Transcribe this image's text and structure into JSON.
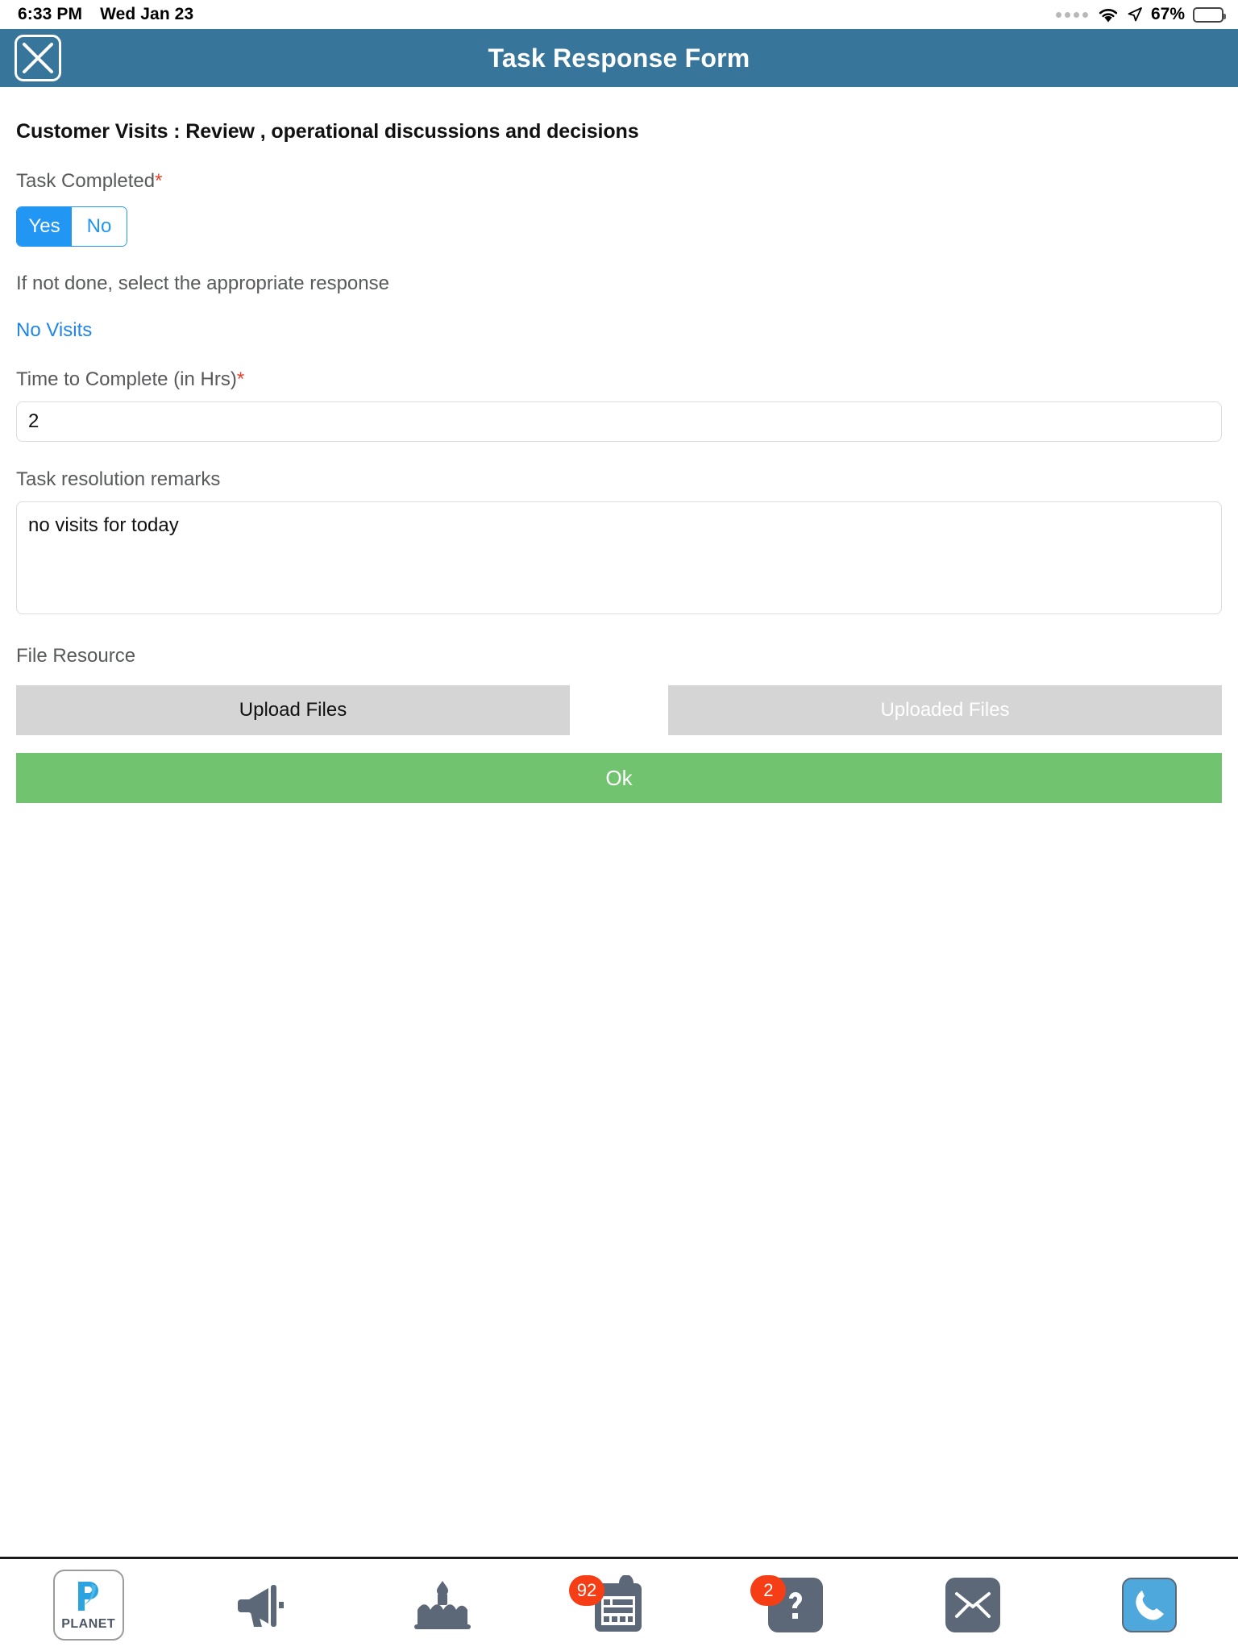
{
  "status_bar": {
    "time": "6:33 PM",
    "date": "Wed Jan 23",
    "battery_percent": "67%",
    "icons": [
      "signal-dots-icon",
      "wifi-icon",
      "location-arrow-icon",
      "battery-icon"
    ]
  },
  "header": {
    "title": "Task Response Form",
    "close_icon": "close-x-icon",
    "background_color": "#37759b"
  },
  "form": {
    "heading": "Customer Visits : Review , operational discussions and decisions",
    "task_completed": {
      "label": "Task Completed",
      "required_marker": "*",
      "options": [
        "Yes",
        "No"
      ],
      "selected": "Yes",
      "accent_color": "#2196f3"
    },
    "not_done": {
      "helper": "If not done, select the appropriate response",
      "link_label": "No Visits",
      "link_color": "#1f86e8"
    },
    "time_to_complete": {
      "label": "Time to Complete (in Hrs)",
      "required_marker": "*",
      "value": "2",
      "placeholder": ""
    },
    "remarks": {
      "label": "Task resolution remarks",
      "value": "no visits for today",
      "placeholder": ""
    },
    "file_resource": {
      "label": "File Resource",
      "upload_label": "Upload Files",
      "uploaded_label": "Uploaded Files"
    },
    "submit": {
      "label": "Ok",
      "color": "#72c370"
    }
  },
  "toolbar": {
    "items": [
      {
        "name": "planet-logo",
        "label": "PLANET",
        "badge": ""
      },
      {
        "name": "megaphone-icon",
        "label": "",
        "badge": ""
      },
      {
        "name": "birthday-cake-icon",
        "label": "",
        "badge": ""
      },
      {
        "name": "tasks-clipboard-icon",
        "label": "",
        "badge": "92"
      },
      {
        "name": "help-question-icon",
        "label": "",
        "badge": "2"
      },
      {
        "name": "mail-envelope-icon",
        "label": "",
        "badge": ""
      },
      {
        "name": "phone-call-icon",
        "label": "",
        "badge": ""
      }
    ],
    "badge_color": "#f53d16"
  }
}
